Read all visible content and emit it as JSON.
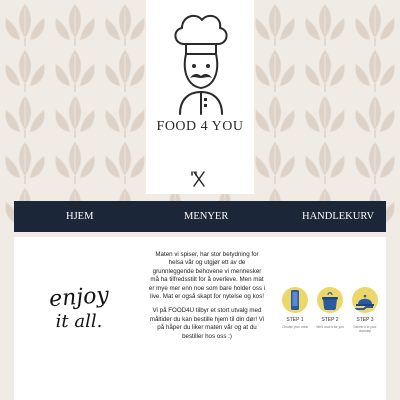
{
  "brand": {
    "name": "FOOD 4 YOU"
  },
  "colors": {
    "nav_bg": "#1b2638",
    "page_bg": "#f1ebe6",
    "step_circle": "#ecd86a",
    "step_icon": "#2c5aa0"
  },
  "nav": {
    "items": [
      {
        "label": "HJEM"
      },
      {
        "label": "MENYER"
      },
      {
        "label": "HANDLEKURV"
      }
    ]
  },
  "hero": {
    "script_line1": "enjoy",
    "script_line2": "it all."
  },
  "description": {
    "paragraph1": "Maten vi spiser, har stor betydning for helsa vår og utgjør ett av de grunnleggende behovene vi mennesker må ha tilfredsstilt for å overleve. Men mat er mye mer enn noe som bare holder oss i live. Mat er også skapt for nytelse og kos!",
    "paragraph2": "Vi på FOOD4U tilbyr et stort utvalg med måltider du kan bestille hjem til din dør! Vi på håper du liker maten vår og at du bestiller hos oss :)"
  },
  "steps": [
    {
      "title": "STEP 1",
      "text": "Choose your meal",
      "icon": "phone-icon"
    },
    {
      "title": "STEP 2",
      "text": "We'll cook it for you",
      "icon": "cooking-pot-icon"
    },
    {
      "title": "STEP 3",
      "text": "Deliver it to your doorstep",
      "icon": "delivery-cloche-icon"
    }
  ]
}
